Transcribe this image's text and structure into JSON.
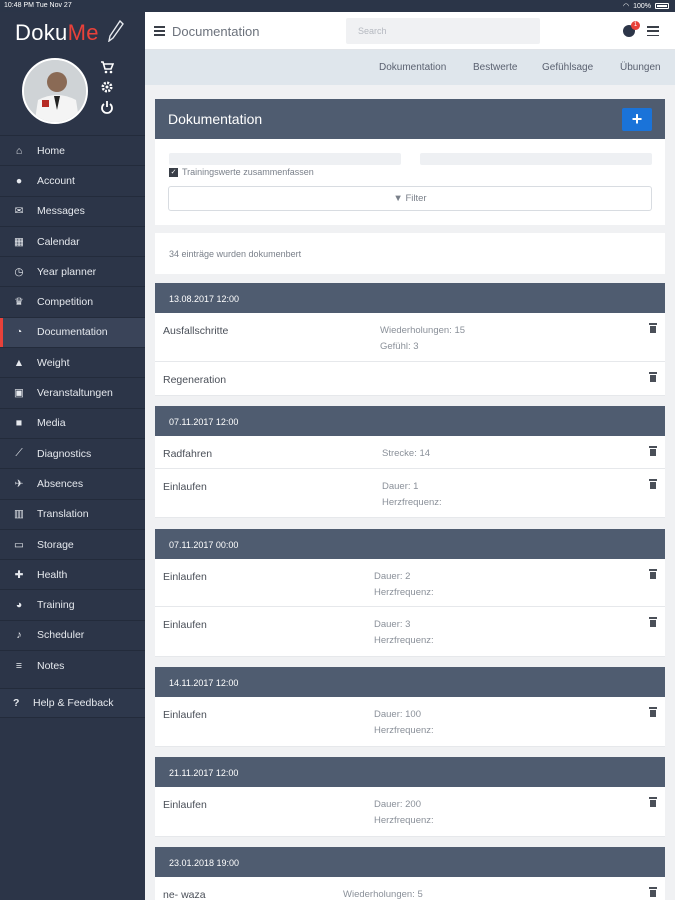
{
  "status": {
    "time": "10:48 PM",
    "date": "Tue Nov 27",
    "battery": "100%"
  },
  "sidebar": {
    "logo_a": "Doku",
    "logo_b": "Me",
    "items": [
      {
        "label": "Home",
        "icon": "home-icon",
        "glyph": "⌂"
      },
      {
        "label": "Account",
        "icon": "user-icon",
        "glyph": "●"
      },
      {
        "label": "Messages",
        "icon": "comments-icon",
        "glyph": "✉"
      },
      {
        "label": "Calendar",
        "icon": "calendar-icon",
        "glyph": "▦"
      },
      {
        "label": "Year planner",
        "icon": "clock-icon",
        "glyph": "◷"
      },
      {
        "label": "Competition",
        "icon": "trophy-icon",
        "glyph": "♛"
      },
      {
        "label": "Documentation",
        "icon": "document-icon",
        "glyph": "◔"
      },
      {
        "label": "Weight",
        "icon": "area-chart-icon",
        "glyph": "▲"
      },
      {
        "label": "Veranstaltungen",
        "icon": "calendar-check-icon",
        "glyph": "▣"
      },
      {
        "label": "Media",
        "icon": "video-camera-icon",
        "glyph": "■"
      },
      {
        "label": "Diagnostics",
        "icon": "line-chart-icon",
        "glyph": "⟋"
      },
      {
        "label": "Absences",
        "icon": "plane-icon",
        "glyph": "✈"
      },
      {
        "label": "Translation",
        "icon": "building-icon",
        "glyph": "▥"
      },
      {
        "label": "Storage",
        "icon": "folder-icon",
        "glyph": "▭"
      },
      {
        "label": "Health",
        "icon": "medkit-icon",
        "glyph": "✚"
      },
      {
        "label": "Training",
        "icon": "pie-chart-icon",
        "glyph": "◕"
      },
      {
        "label": "Scheduler",
        "icon": "bell-icon",
        "glyph": "♪"
      },
      {
        "label": "Notes",
        "icon": "list-icon",
        "glyph": "≡"
      }
    ],
    "help": "Help & Feedback"
  },
  "topbar": {
    "title": "Documentation",
    "search_placeholder": "Search",
    "badge": "1"
  },
  "subnav": [
    "Dokumentation",
    "Bestwerte",
    "Gefühlsage",
    "Übungen"
  ],
  "panel": {
    "title": "Dokumentation",
    "add": "+",
    "checkbox_label": "Trainingswerte zusammenfassen",
    "filter": "Filter",
    "count": "34 einträge wurden dokumenbert"
  },
  "groups": [
    {
      "date": "13.08.2017 12:00",
      "entries": [
        {
          "name": "Ausfallschritte",
          "v1": "Wiederholungen: 15",
          "v2": "Gefühl: 3"
        },
        {
          "name": "Regeneration",
          "v1": "",
          "v2": ""
        }
      ]
    },
    {
      "date": "07.11.2017 12:00",
      "entries": [
        {
          "name": "Radfahren",
          "v1": "Strecke: 14",
          "v2": ""
        },
        {
          "name": "Einlaufen",
          "v1": "Dauer: 1",
          "v2": "Herzfrequenz:"
        }
      ]
    },
    {
      "date": "07.11.2017 00:00",
      "entries": [
        {
          "name": "Einlaufen",
          "v1": "Dauer: 2",
          "v2": "Herzfrequenz:"
        },
        {
          "name": "Einlaufen",
          "v1": "Dauer: 3",
          "v2": "Herzfrequenz:"
        }
      ]
    },
    {
      "date": "14.11.2017 12:00",
      "entries": [
        {
          "name": "Einlaufen",
          "v1": "Dauer: 100",
          "v2": "Herzfrequenz:"
        }
      ]
    },
    {
      "date": "21.11.2017 12:00",
      "entries": [
        {
          "name": "Einlaufen",
          "v1": "Dauer: 200",
          "v2": "Herzfrequenz:"
        }
      ]
    },
    {
      "date": "23.01.2018 19:00",
      "entries": [
        {
          "name": "ne- waza",
          "v1": "Wiederholungen: 5",
          "v2": ""
        }
      ]
    }
  ]
}
